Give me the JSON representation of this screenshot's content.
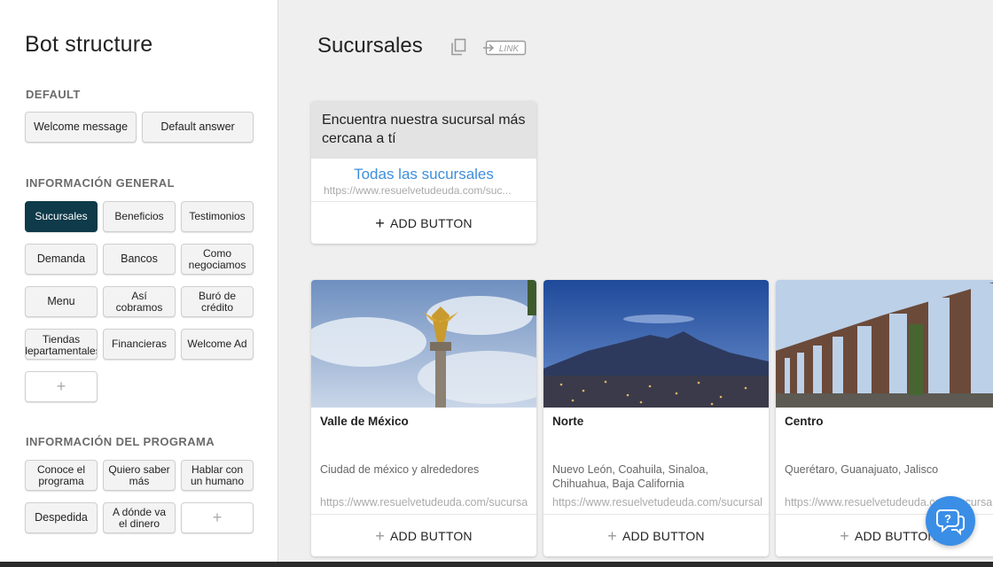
{
  "sidebar": {
    "title": "Bot structure",
    "groups": [
      {
        "label": "DEFAULT",
        "items": [
          "Welcome message",
          "Default answer"
        ]
      },
      {
        "label": "INFORMACIÓN GENERAL",
        "items": [
          "Sucursales",
          "Beneficios",
          "Testimonios",
          "Demanda",
          "Bancos",
          "Como negociamos",
          "Menu",
          "Así cobramos",
          "Buró de crédito",
          "Tiendas departamentales",
          "Financieras",
          "Welcome Ad",
          "+"
        ]
      },
      {
        "label": "INFORMACIÓN DEL PROGRAMA",
        "items": [
          "Conoce el programa",
          "Quiero saber más",
          "Hablar con un humano",
          "Despedida",
          "A dónde va el dinero",
          "+"
        ]
      }
    ],
    "active_item": "Sucursales"
  },
  "main": {
    "title": "Sucursales",
    "link_label": "LINK",
    "text_card": {
      "message": "Encuentra nuestra sucursal más cercana a tí",
      "button_title": "Todas las sucursales",
      "button_url": "https://www.resuelvetudeuda.com/suc...",
      "add_button": "ADD BUTTON"
    },
    "gallery": [
      {
        "title": "Valle de México",
        "subtitle": "Ciudad de méxico y alrededores",
        "url": "https://www.resuelvetudeuda.com/sucursa",
        "add_button": "ADD BUTTON"
      },
      {
        "title": "Norte",
        "subtitle": "Nuevo León, Coahuila, Sinaloa, Chihuahua, Baja California",
        "url": "https://www.resuelvetudeuda.com/sucursal",
        "add_button": "ADD BUTTON"
      },
      {
        "title": "Centro",
        "subtitle": "Querétaro, Guanajuato, Jalisco",
        "url": "https://www.resuelvetudeuda.com/sucursa",
        "add_button": "ADD BUTTON"
      }
    ]
  },
  "colors": {
    "active_item": "#0e3a4a",
    "link_blue": "#3d8edb",
    "chat_bubble": "#3a8ee6"
  },
  "icons": [
    "copy-icon",
    "link-icon",
    "plus-icon",
    "chat-help-icon"
  ]
}
